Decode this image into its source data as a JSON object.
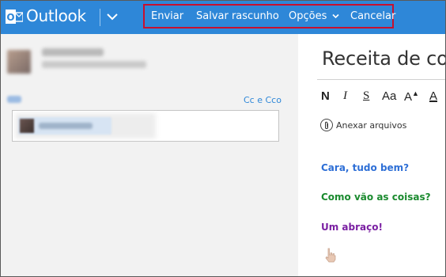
{
  "app": {
    "name": "Outlook",
    "brand_color": "#2e87d8"
  },
  "commands": {
    "send": "Enviar",
    "save_draft": "Salvar rascunho",
    "options": "Opções",
    "cancel": "Cancelar"
  },
  "recipients": {
    "cc_link": "Cc e Cco"
  },
  "message": {
    "subject": "Receita de com",
    "attach_label": "Anexar arquivos",
    "body": [
      {
        "text": "Cara, tudo bem?",
        "color": "#2e6fd6"
      },
      {
        "text": "Como vão as coisas?",
        "color": "#1a8a2e"
      },
      {
        "text": "Um abraço!",
        "color": "#7a1fa2"
      }
    ]
  },
  "toolbar": {
    "bold": "N",
    "italic": "I",
    "underline": "S",
    "font_size": "Aa",
    "grow_font": "A",
    "font_color": "A"
  },
  "icons": [
    "outlook-logo-icon",
    "chevron-down-icon",
    "paperclip-icon",
    "hand-pointer-icon"
  ]
}
